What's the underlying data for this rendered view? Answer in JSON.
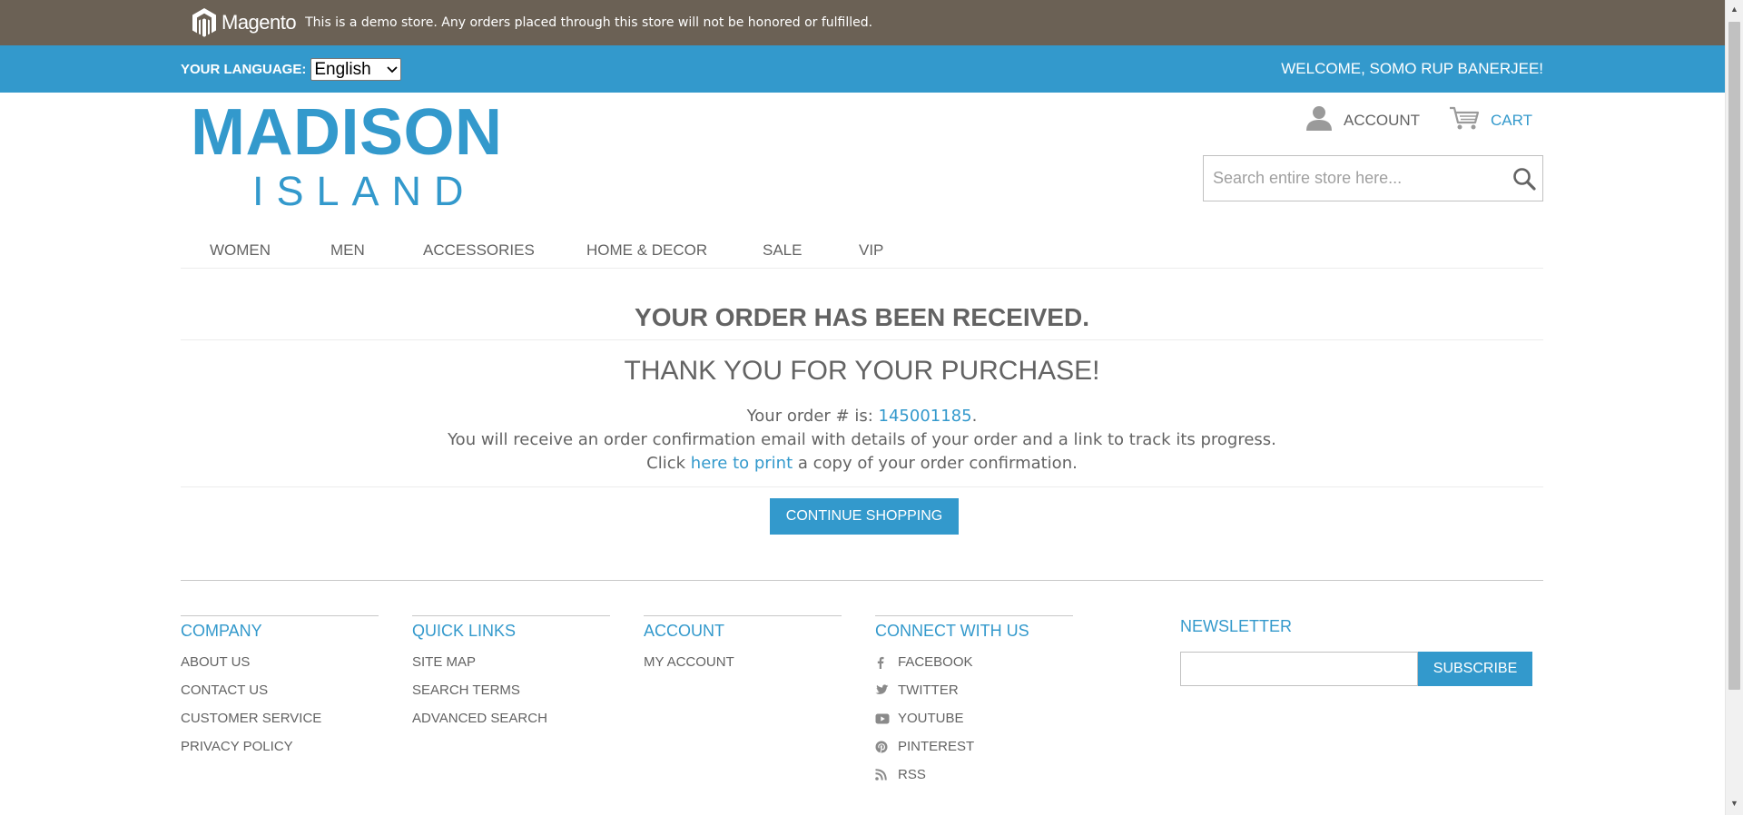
{
  "demo_bar": {
    "logo_text": "Magento",
    "notice": "This is a demo store. Any orders placed through this store will not be honored or fulfilled."
  },
  "lang_bar": {
    "label": "YOUR LANGUAGE:",
    "selected": "English",
    "welcome": "WELCOME, SOMO RUP BANERJEE!"
  },
  "header": {
    "logo_main": "MADISON",
    "logo_sub": "ISLAND",
    "account_label": "ACCOUNT",
    "cart_label": "CART",
    "search_placeholder": "Search entire store here..."
  },
  "nav": [
    "WOMEN",
    "MEN",
    "ACCESSORIES",
    "HOME & DECOR",
    "SALE",
    "VIP"
  ],
  "main": {
    "heading": "YOUR ORDER HAS BEEN RECEIVED.",
    "subheading": "THANK YOU FOR YOUR PURCHASE!",
    "order_prefix": "Your order # is: ",
    "order_number": "145001185",
    "order_suffix": ".",
    "email_msg": "You will receive an order confirmation email with details of your order and a link to track its progress.",
    "print_prefix": "Click ",
    "print_link": "here to print",
    "print_suffix": " a copy of your order confirmation.",
    "continue_label": "CONTINUE SHOPPING"
  },
  "footer": {
    "company": {
      "title": "COMPANY",
      "items": [
        "ABOUT US",
        "CONTACT US",
        "CUSTOMER SERVICE",
        "PRIVACY POLICY"
      ]
    },
    "quick_links": {
      "title": "QUICK LINKS",
      "items": [
        "SITE MAP",
        "SEARCH TERMS",
        "ADVANCED SEARCH"
      ]
    },
    "account": {
      "title": "ACCOUNT",
      "items": [
        "MY ACCOUNT"
      ]
    },
    "connect": {
      "title": "CONNECT WITH US",
      "items": [
        {
          "label": "FACEBOOK",
          "icon": "facebook-icon"
        },
        {
          "label": "TWITTER",
          "icon": "twitter-icon"
        },
        {
          "label": "YOUTUBE",
          "icon": "youtube-icon"
        },
        {
          "label": "PINTEREST",
          "icon": "pinterest-icon"
        },
        {
          "label": "RSS",
          "icon": "rss-icon"
        }
      ]
    },
    "newsletter": {
      "title": "NEWSLETTER",
      "button": "SUBSCRIBE"
    }
  },
  "colors": {
    "brand_blue": "#3399cc",
    "demo_bar": "#6b6155",
    "text": "#636363"
  }
}
